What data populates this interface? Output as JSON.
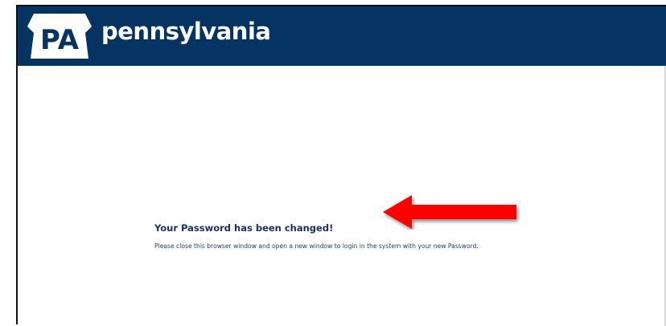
{
  "header": {
    "logo_text": "PA",
    "brand_name": "pennsylvania"
  },
  "message": {
    "title": "Your Password has been changed!",
    "body": "Please close this browser window and open a new window to login in the system with your new Password."
  },
  "annotation": {
    "arrow_icon": "red-arrow-left-icon",
    "arrow_color": "#ff0000"
  },
  "colors": {
    "header_bg": "#063462",
    "title_text": "#1d2e6f"
  }
}
